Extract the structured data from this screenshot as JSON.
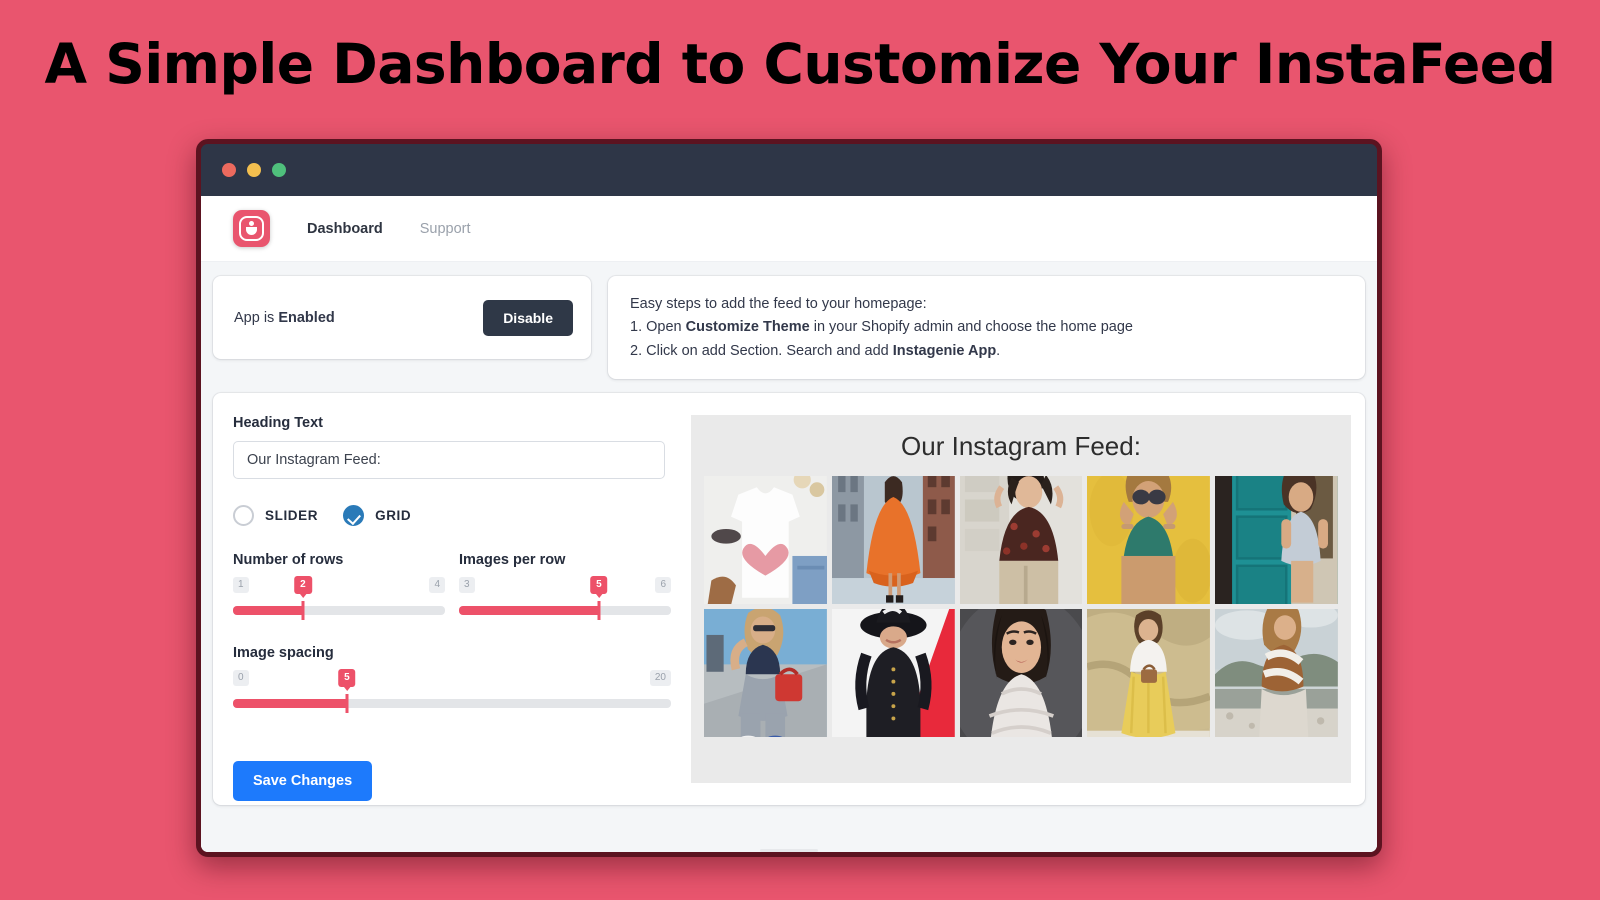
{
  "hero": {
    "title": "A Simple Dashboard to Customize Your InstaFeed",
    "background_color": "#e9556e",
    "title_color": "#000000"
  },
  "window": {
    "chrome_color": "#2e3647",
    "border_color": "#5c1320",
    "traffic_lights": [
      {
        "name": "close",
        "color": "#ec6a5e"
      },
      {
        "name": "minimize",
        "color": "#f3bf4f"
      },
      {
        "name": "maximize",
        "color": "#4fc07c"
      }
    ]
  },
  "nav": {
    "logo_name": "instagenie-logo",
    "logo_color": "#e9556e",
    "items": [
      {
        "label": "Dashboard",
        "active": true
      },
      {
        "label": "Support",
        "active": false
      }
    ]
  },
  "status": {
    "prefix": "App is ",
    "state": "Enabled",
    "button_label": "Disable",
    "button_color": "#2f3847"
  },
  "steps": {
    "intro": "Easy steps to add the feed to your homepage:",
    "line1_pre": "1. Open ",
    "line1_bold": "Customize Theme",
    "line1_post": " in your Shopify admin and choose the home page",
    "line2_pre": "2. Click on add Section. Search and add ",
    "line2_bold": "Instagenie App",
    "line2_post": "."
  },
  "settings": {
    "heading_label": "Heading Text",
    "heading_value": "Our Instagram Feed:",
    "heading_placeholder": "Our Instagram Feed:",
    "layout_options": [
      {
        "label": "SLIDER",
        "selected": false
      },
      {
        "label": "GRID",
        "selected": true
      }
    ],
    "selected_color": "#2a7ab8",
    "sliders": [
      {
        "title": "Number of rows",
        "min": "1",
        "max": "4",
        "value": "2",
        "percent": 33
      },
      {
        "title": "Images per row",
        "min": "3",
        "max": "6",
        "value": "5",
        "percent": 66
      },
      {
        "title": "Image spacing",
        "min": "0",
        "max": "20",
        "value": "5",
        "percent": 26
      }
    ],
    "slider_accent": "#ed5169",
    "save_label": "Save Changes",
    "save_color": "#1d7afc"
  },
  "preview": {
    "heading": "Our Instagram Feed:",
    "background_color": "#eaeaea",
    "rows": 2,
    "columns": 5,
    "photos": [
      {
        "alt": "white-tshirt-heart-flatlay"
      },
      {
        "alt": "orange-dress-city-street"
      },
      {
        "alt": "floral-top-stone-wall"
      },
      {
        "alt": "sunglasses-yellow-wall"
      },
      {
        "alt": "grey-dress-teal-door"
      },
      {
        "alt": "streetwear-red-bag-stairs"
      },
      {
        "alt": "black-hat-coat-red-backdrop"
      },
      {
        "alt": "white-ruffle-top-dark-portrait"
      },
      {
        "alt": "white-top-yellow-skirt-cliff"
      },
      {
        "alt": "brown-white-top-beach"
      }
    ]
  }
}
